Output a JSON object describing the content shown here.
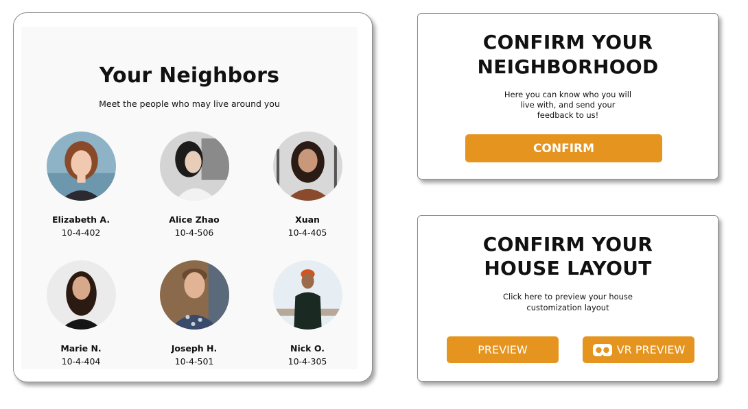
{
  "neighbors": {
    "title": "Your Neighbors",
    "subtitle": "Meet the people who may live around you",
    "people": [
      {
        "name": "Elizabeth A.",
        "unit": "10-4-402",
        "avatar": "woman-red-hair-avatar"
      },
      {
        "name": "Alice Zhao",
        "unit": "10-4-506",
        "avatar": "woman-black-hair-avatar"
      },
      {
        "name": "Xuan",
        "unit": "10-4-405",
        "avatar": "woman-smiling-palms-avatar"
      },
      {
        "name": "Marie N.",
        "unit": "10-4-404",
        "avatar": "woman-dark-hair-avatar"
      },
      {
        "name": "Joseph H.",
        "unit": "10-4-501",
        "avatar": "man-smiling-avatar"
      },
      {
        "name": "Nick O.",
        "unit": "10-4-305",
        "avatar": "man-orange-beanie-avatar"
      }
    ]
  },
  "confirm_neighborhood": {
    "title_line1": "CONFIRM YOUR",
    "title_line2": "NEIGHBORHOOD",
    "text_line1": "Here you can know who you will",
    "text_line2": "live with, and send your",
    "text_line3": "feedback to us!",
    "button_label": "CONFIRM"
  },
  "confirm_layout": {
    "title_line1": "CONFIRM YOUR",
    "title_line2": "HOUSE LAYOUT",
    "text_line1": "Click here to preview your house",
    "text_line2": "customization layout",
    "preview_label": "PREVIEW",
    "vr_preview_label": "VR PREVIEW"
  },
  "colors": {
    "accent": "#e5951f",
    "panel": "#f9f9f9",
    "border": "#8a8a8a"
  }
}
